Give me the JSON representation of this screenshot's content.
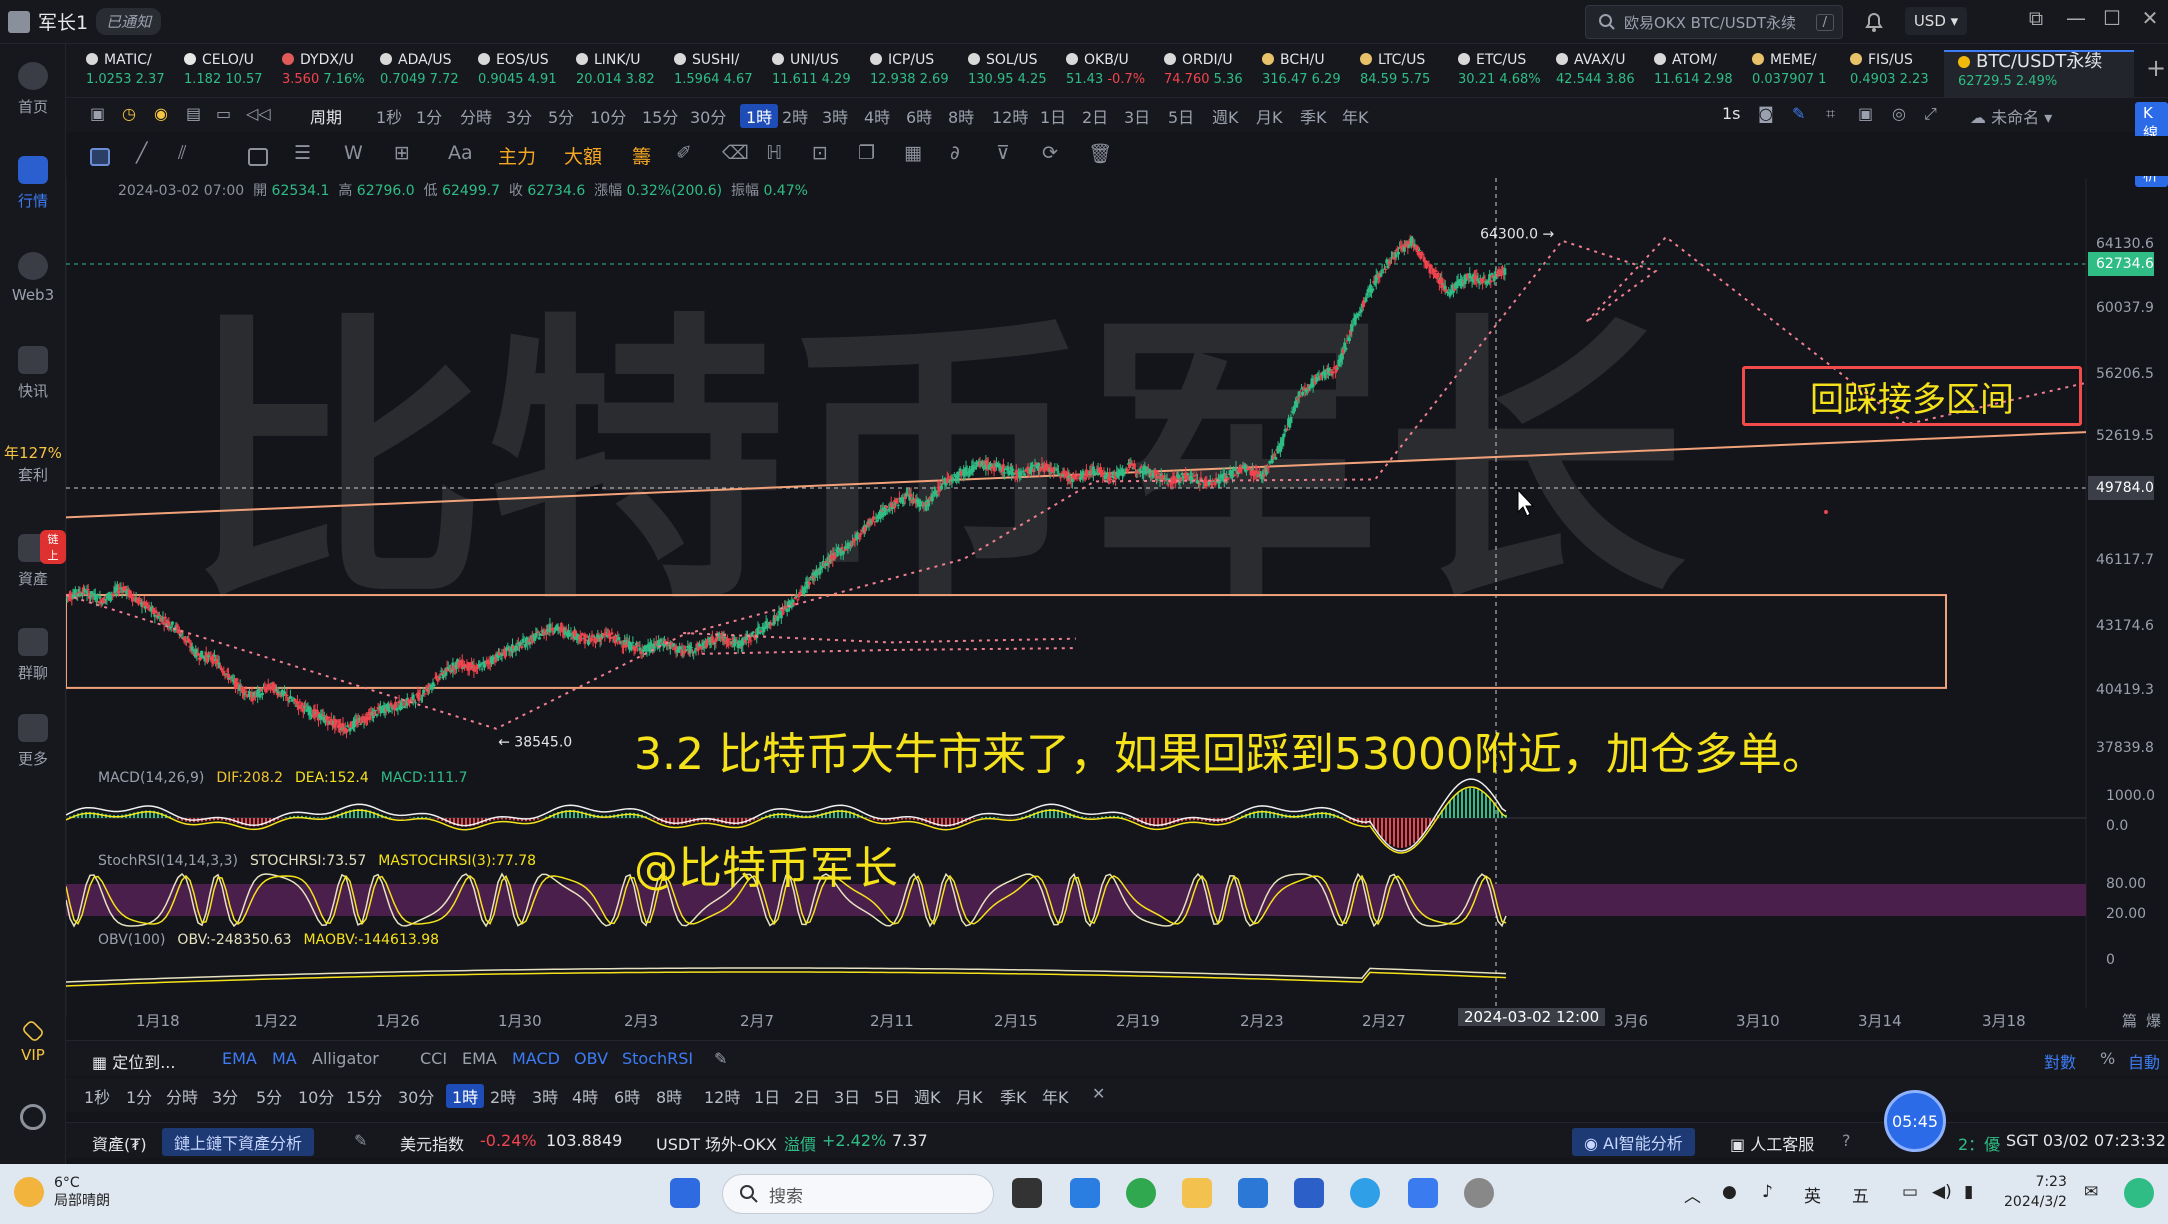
{
  "window": {
    "user": "军长1",
    "status": "已通知",
    "search_placeholder": "欧易OKX BTC/USDT永续",
    "search_kbd": "/",
    "currency": "USD"
  },
  "sidebar": {
    "items": [
      {
        "label": "首页",
        "icon": "home-icon"
      },
      {
        "label": "行情",
        "icon": "market-chart-icon",
        "active": true
      },
      {
        "label": "Web3",
        "icon": "web3-icon"
      },
      {
        "label": "快讯",
        "icon": "news-icon"
      },
      {
        "label": "年127%",
        "sub": "套利"
      },
      {
        "label": "資產",
        "icon": "wallet-icon",
        "badge": "链上"
      },
      {
        "label": "群聊",
        "icon": "chat-icon"
      },
      {
        "label": "更多",
        "icon": "grid-icon"
      },
      {
        "label": "VIP",
        "icon": "vip-icon"
      }
    ]
  },
  "tickers": [
    {
      "name": "MATIC/",
      "price": "1.0253",
      "change": "2.37"
    },
    {
      "name": "CELO/U",
      "price": "1.182",
      "change": "10.57"
    },
    {
      "name": "DYDX/U",
      "price": "3.560",
      "change": "7.16%"
    },
    {
      "name": "ADA/US",
      "price": "0.7049",
      "change": "7.72"
    },
    {
      "name": "EOS/US",
      "price": "0.9045",
      "change": "4.91"
    },
    {
      "name": "LINK/U",
      "price": "20.014",
      "change": "3.82"
    },
    {
      "name": "SUSHI/",
      "price": "1.5964",
      "change": "4.67"
    },
    {
      "name": "UNI/US",
      "price": "11.611",
      "change": "4.29"
    },
    {
      "name": "ICP/US",
      "price": "12.938",
      "change": "2.69"
    },
    {
      "name": "SOL/US",
      "price": "130.95",
      "change": "4.25"
    },
    {
      "name": "OKB/U",
      "price": "51.43",
      "change": "-0.7%"
    },
    {
      "name": "ORDI/U",
      "price": "74.760",
      "change": "5.36"
    },
    {
      "name": "BCH/U",
      "price": "316.47",
      "change": "6.29"
    },
    {
      "name": "LTC/US",
      "price": "84.59",
      "change": "5.75"
    },
    {
      "name": "ETC/US",
      "price": "30.21",
      "change": "4.68%"
    },
    {
      "name": "AVAX/U",
      "price": "42.544",
      "change": "3.86"
    },
    {
      "name": "ATOM/",
      "price": "11.614",
      "change": "2.98"
    },
    {
      "name": "MEME/",
      "price": "0.037907",
      "change": "1"
    },
    {
      "name": "FIS/US",
      "price": "0.4903",
      "change": "2.23"
    },
    {
      "name": "BTC/USDT永续",
      "price": "62729.5",
      "change": "2.49%",
      "active": true
    }
  ],
  "intervals": [
    "周期",
    "1秒",
    "1分",
    "分時",
    "3分",
    "5分",
    "10分",
    "15分",
    "30分",
    "1時",
    "2時",
    "3時",
    "4時",
    "6時",
    "8時",
    "12時",
    "1日",
    "2日",
    "3日",
    "5日",
    "週K",
    "月K",
    "季K",
    "年K"
  ],
  "interval_active": "1時",
  "toolbar_right": {
    "speed": "1s",
    "layout_name": "未命名",
    "kline_analysis": "K線分析"
  },
  "draw_tools": {
    "main": "主力",
    "big": "大額",
    "chips": "籌",
    "text_tool": "Aa"
  },
  "ohlc": {
    "datetime": "2024-03-02 07:00",
    "open_label": "開",
    "open": "62534.1",
    "high_label": "高",
    "high": "62796.0",
    "low_label": "低",
    "low": "62499.7",
    "close_label": "收",
    "close": "62734.6",
    "change_label": "漲幅",
    "change": "0.32%(200.6)",
    "amp_label": "振幅",
    "amp": "0.47%"
  },
  "chart_data": {
    "type": "candlestick",
    "price_axis": [
      "64130.6",
      "60037.9",
      "56206.5",
      "52619.5",
      "49784.0",
      "46117.7",
      "43174.6",
      "40419.3",
      "37839.8"
    ],
    "current_price": "62734.6",
    "crosshair_price": "49784.0",
    "high_marker": "64300.0",
    "low_marker": "38545.0",
    "macd_axis": [
      "1000.0",
      "0.0"
    ],
    "stoch_axis": [
      "80.00",
      "20.00"
    ],
    "obv_axis": [
      "0"
    ],
    "time_axis": [
      "1月18",
      "1月22",
      "1月26",
      "1月30",
      "2月3",
      "2月7",
      "2月11",
      "2月15",
      "2月19",
      "2月23",
      "2月27",
      "3月6",
      "3月10",
      "3月14",
      "3月18"
    ],
    "crosshair_time": "2024-03-02 12:00",
    "axis_right_labels": [
      "篇",
      "爆"
    ],
    "path": [
      [
        0,
        45500
      ],
      [
        2,
        45800
      ],
      [
        4,
        45300
      ],
      [
        6,
        46000
      ],
      [
        8,
        45200
      ],
      [
        10,
        44500
      ],
      [
        12,
        43800
      ],
      [
        14,
        42500
      ],
      [
        16,
        42200
      ],
      [
        17,
        41000
      ],
      [
        18,
        40200
      ],
      [
        19,
        40800
      ],
      [
        20,
        40100
      ],
      [
        21,
        39500
      ],
      [
        22,
        39000
      ],
      [
        23,
        38545
      ],
      [
        24,
        39100
      ],
      [
        25,
        39600
      ],
      [
        26,
        39800
      ],
      [
        27,
        40300
      ],
      [
        28,
        41300
      ],
      [
        29,
        42000
      ],
      [
        30,
        41700
      ],
      [
        31,
        42300
      ],
      [
        32,
        42800
      ],
      [
        33,
        43300
      ],
      [
        34,
        43900
      ],
      [
        35,
        43600
      ],
      [
        36,
        43200
      ],
      [
        37,
        43500
      ],
      [
        38,
        43000
      ],
      [
        39,
        42700
      ],
      [
        40,
        43100
      ],
      [
        41,
        42600
      ],
      [
        42,
        42900
      ],
      [
        43,
        43400
      ],
      [
        44,
        43000
      ],
      [
        45,
        43600
      ],
      [
        46,
        44400
      ],
      [
        47,
        45300
      ],
      [
        48,
        46600
      ],
      [
        49,
        47600
      ],
      [
        50,
        48300
      ],
      [
        51,
        49400
      ],
      [
        52,
        50200
      ],
      [
        53,
        50800
      ],
      [
        54,
        50300
      ],
      [
        55,
        51600
      ],
      [
        56,
        52100
      ],
      [
        57,
        52500
      ],
      [
        58,
        52300
      ],
      [
        59,
        52000
      ],
      [
        60,
        52400
      ],
      [
        61,
        52100
      ],
      [
        62,
        51700
      ],
      [
        63,
        52200
      ],
      [
        64,
        51800
      ],
      [
        65,
        52400
      ],
      [
        66,
        52100
      ],
      [
        67,
        51600
      ],
      [
        68,
        51900
      ],
      [
        69,
        51500
      ],
      [
        70,
        51800
      ],
      [
        71,
        52300
      ],
      [
        72,
        51900
      ],
      [
        73,
        53500
      ],
      [
        74,
        56200
      ],
      [
        75,
        57100
      ],
      [
        76,
        57600
      ],
      [
        77,
        60200
      ],
      [
        78,
        62100
      ],
      [
        79,
        63500
      ],
      [
        80,
        64300
      ],
      [
        81,
        62800
      ],
      [
        82,
        61600
      ],
      [
        83,
        62400
      ],
      [
        84,
        62200
      ],
      [
        85,
        62734
      ]
    ]
  },
  "indicators": {
    "macd": {
      "label": "MACD(14,26,9)",
      "dif": "DIF:208.2",
      "dea": "DEA:152.4",
      "macd": "MACD:111.7"
    },
    "stoch": {
      "label": "StochRSI(14,14,3,3)",
      "k": "STOCHRSI:73.57",
      "d": "MASTOCHRSI(3):77.78"
    },
    "obv": {
      "label": "OBV(100)",
      "obv": "OBV:-248350.63",
      "ma": "MAOBV:-144613.98"
    }
  },
  "annotations": {
    "main_text": "3.2 比特币大牛市来了，如果回踩到53000附近，加仓多单。",
    "author": "@比特币军长",
    "zone_label": "回踩接多区间",
    "watermark": "比特币军长"
  },
  "indicator_bar": {
    "locate": "定位到...",
    "main_items": [
      "EMA",
      "MA",
      "Alligator"
    ],
    "sub_items": [
      "CCI",
      "EMA",
      "MACD",
      "OBV",
      "StochRSI"
    ],
    "right_items": [
      "對數",
      "%",
      "自動"
    ]
  },
  "intervals2": [
    "1秒",
    "1分",
    "分時",
    "3分",
    "5分",
    "10分",
    "15分",
    "30分",
    "1時",
    "2時",
    "3時",
    "4時",
    "6時",
    "8時",
    "12時",
    "1日",
    "2日",
    "3日",
    "5日",
    "週K",
    "月K",
    "季K",
    "年K"
  ],
  "status": {
    "assets": "資產(₮)",
    "asset_btn": "鏈上鏈下資產分析",
    "usd_index_label": "美元指数",
    "usd_index_change": "-0.24%",
    "usd_index": "103.8849",
    "usdt_label": "USDT 场外-OKX",
    "premium_label": "溢價",
    "premium_change": "+2.42%",
    "premium": "7.37",
    "ai_btn": "AI智能分析",
    "service": "人工客服",
    "quality": "2：優",
    "clock": "SGT 03/02 07:23:32",
    "bubble_time": "05:45"
  },
  "taskbar": {
    "temp": "6°C",
    "weather": "局部晴朗",
    "search": "搜索",
    "lang1": "英",
    "lang2": "五",
    "time": "7:23",
    "date": "2024/3/2"
  },
  "colors": {
    "up": "#2fbd85",
    "down": "#f0444e",
    "accent": "#3d7cf5",
    "annot": "#f5e21b",
    "zone": "#f14b4b"
  }
}
